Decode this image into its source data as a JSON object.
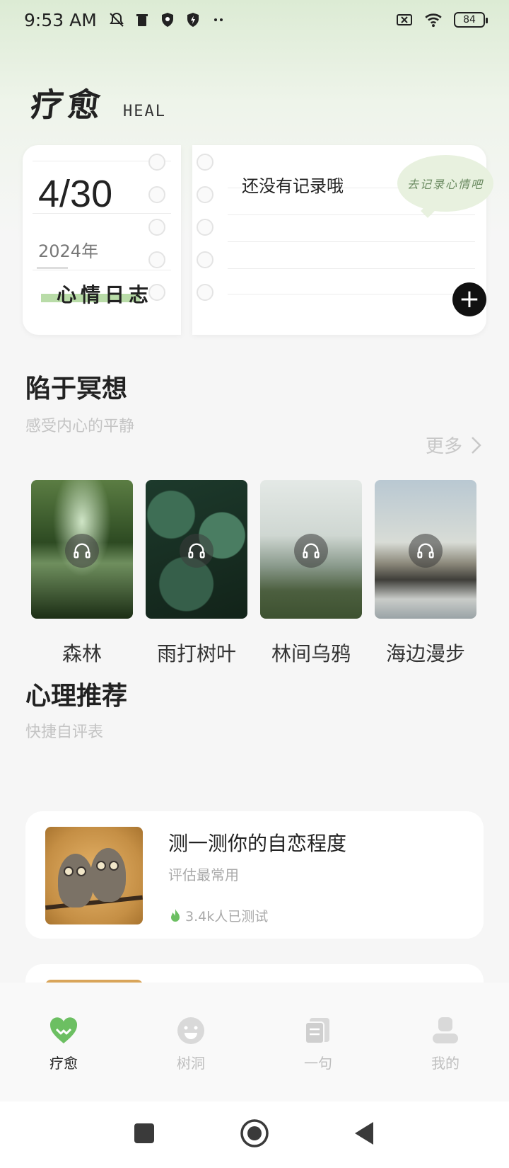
{
  "status_bar": {
    "time": "9:53 AM",
    "battery": "84",
    "left_icons": [
      "mute-icon",
      "trash-icon",
      "shield-icon",
      "shield-bolt-icon",
      "more-dots-icon"
    ],
    "right_icons": [
      "sim-off-icon",
      "wifi-icon",
      "battery-icon"
    ]
  },
  "header": {
    "title_cn": "疗愈",
    "title_en": "HEAL"
  },
  "diary": {
    "date": "4/30",
    "year": "2024年",
    "label": "心情日志",
    "empty_text": "还没有记录哦",
    "bubble_text": "去记录心情吧",
    "add_symbol": "+"
  },
  "meditation": {
    "title": "陷于冥想",
    "subtitle": "感受内心的平静",
    "more_label": "更多",
    "items": [
      {
        "label": "森林"
      },
      {
        "label": "雨打树叶"
      },
      {
        "label": "林间乌鸦"
      },
      {
        "label": "海边漫步"
      }
    ]
  },
  "recommend": {
    "title": "心理推荐",
    "subtitle": "快捷自评表",
    "cards": [
      {
        "title": "测一测你的自恋程度",
        "subtitle": "评估最常用",
        "meta": "3.4k人已测试"
      }
    ]
  },
  "bottom_nav": {
    "items": [
      {
        "label": "疗愈",
        "icon": "heart-pulse-icon",
        "active": true
      },
      {
        "label": "树洞",
        "icon": "smile-icon",
        "active": false
      },
      {
        "label": "一句",
        "icon": "quote-card-icon",
        "active": false
      },
      {
        "label": "我的",
        "icon": "profile-icon",
        "active": false
      }
    ]
  },
  "colors": {
    "accent_green": "#6cbf62",
    "header_gradient": "#dcebd4",
    "inactive_gray": "#bfbfbf"
  }
}
